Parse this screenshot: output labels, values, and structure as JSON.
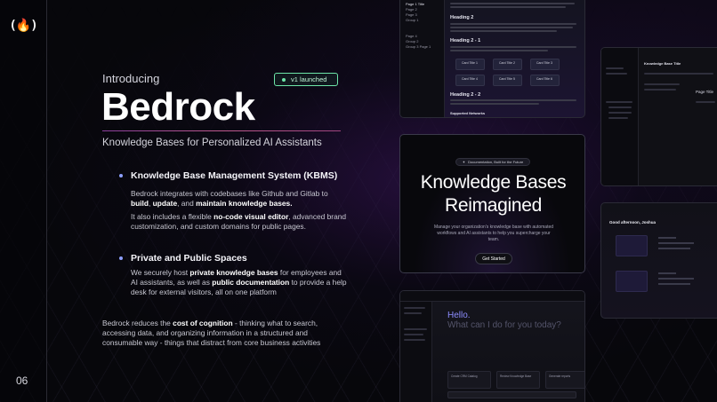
{
  "slide": {
    "logo": "(🔥)",
    "page_number": "06",
    "intro": "Introducing",
    "badge": "v1 launched",
    "title": "Bedrock",
    "subtitle": "Knowledge Bases for Personalized AI Assistants",
    "features": [
      {
        "heading": "Knowledge Base Management System (KBMS)",
        "paragraphs": [
          [
            "Bedrock integrates with codebases like Github and Gitlab to ",
            {
              "b": "build"
            },
            ", ",
            {
              "b": "update"
            },
            ", and ",
            {
              "b": "maintain knowledge bases."
            }
          ],
          [
            "It also includes a flexible ",
            {
              "b": "no-code visual editor"
            },
            ", advanced brand customization, and custom domains for public pages."
          ]
        ]
      },
      {
        "heading": "Private and Public Spaces",
        "paragraphs": [
          [
            "We securely host ",
            {
              "b": "private knowledge bases"
            },
            " for employees and AI assistants, as well as ",
            {
              "b": "public documentation"
            },
            " to provide a help desk for external visitors, all on one platform"
          ]
        ]
      }
    ],
    "closing": [
      "Bedrock reduces the ",
      {
        "b": "cost of cognition"
      },
      " - thinking what to search, accessing data, and organizing information in a structured and consumable way - things that distract from core business activities"
    ]
  },
  "screens": {
    "doc": {
      "sidebar_items": [
        "Page 1 Title",
        "Page 2",
        "Page 3",
        "Group 1",
        "Page 4",
        "Group 2",
        "Group 3 Page 1"
      ],
      "heading_2": "Heading 2",
      "heading_2_1": "Heading 2 - 1",
      "heading_2_2": "Heading 2 - 2",
      "cards": [
        "Card Title 1",
        "Card Title 2",
        "Card Title 3",
        "Card Title 4",
        "Card Title 5",
        "Card Title 6"
      ],
      "footer_label": "Supported Networks"
    },
    "hero": {
      "pill": "Documentation, Built for the Future",
      "title_line1": "Knowledge Bases",
      "title_line2": "Reimagined",
      "description": "Manage your organization's knowledge base with automated workflows and AI assistants to help you supercharge your team.",
      "cta": "Get Started"
    },
    "chat": {
      "hello": "Hello.",
      "prompt": "What can I do for you today?",
      "suggestions": [
        "Create CRM Catalog",
        "Review Knowledge Base",
        "Generate reports"
      ]
    },
    "app": {
      "editor_title": "Knowledge Base Title",
      "page_title": "Page Title"
    },
    "dashboard": {
      "greeting": "Good afternoon, Joshua"
    }
  }
}
